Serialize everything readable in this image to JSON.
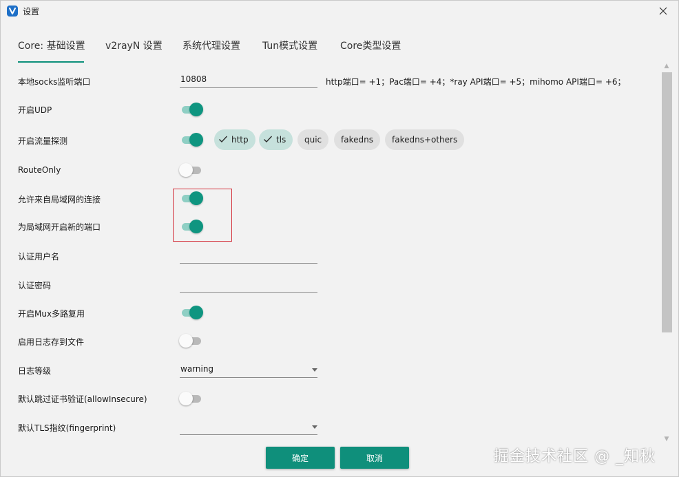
{
  "window": {
    "title": "设置",
    "close_glyph": "✕"
  },
  "tabs": [
    {
      "label": "Core: 基础设置",
      "active": true
    },
    {
      "label": "v2rayN 设置",
      "active": false
    },
    {
      "label": "系统代理设置",
      "active": false
    },
    {
      "label": "Tun模式设置",
      "active": false
    },
    {
      "label": "Core类型设置",
      "active": false
    }
  ],
  "settings": {
    "socks_port": {
      "label": "本地socks监听端口",
      "value": "10808",
      "hint": "http端口= +1；Pac端口= +4；*ray API端口= +5；mihomo API端口= +6；"
    },
    "udp": {
      "label": "开启UDP",
      "on": true
    },
    "sniffing": {
      "label": "开启流量探测",
      "on": true,
      "chips": [
        {
          "label": "http",
          "selected": true
        },
        {
          "label": "tls",
          "selected": true
        },
        {
          "label": "quic",
          "selected": false
        },
        {
          "label": "fakedns",
          "selected": false
        },
        {
          "label": "fakedns+others",
          "selected": false
        }
      ]
    },
    "route_only": {
      "label": "RouteOnly",
      "on": false
    },
    "allow_lan": {
      "label": "允许来自局域网的连接",
      "on": true
    },
    "new_lan_port": {
      "label": "为局域网开启新的端口",
      "on": true
    },
    "auth_user": {
      "label": "认证用户名",
      "value": ""
    },
    "auth_pass": {
      "label": "认证密码",
      "value": ""
    },
    "mux": {
      "label": "开启Mux多路复用",
      "on": true
    },
    "log_to_file": {
      "label": "启用日志存到文件",
      "on": false
    },
    "log_level": {
      "label": "日志等级",
      "value": "warning"
    },
    "allow_insecure": {
      "label": "默认跳过证书验证(allowInsecure)",
      "on": false
    },
    "fingerprint": {
      "label": "默认TLS指纹(fingerprint)",
      "value": ""
    }
  },
  "buttons": {
    "ok": "确定",
    "cancel": "取消"
  },
  "watermark": "掘金技术社区 @ _知秋",
  "colors": {
    "accent": "#0f8f7b",
    "toggle_on": "#0f9580",
    "highlight": "#d32f3a"
  }
}
